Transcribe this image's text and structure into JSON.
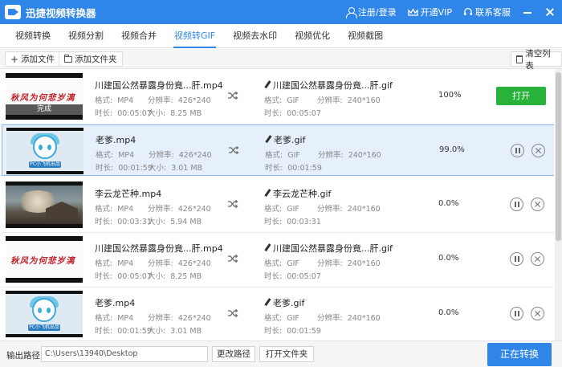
{
  "app": {
    "title": "迅捷视频转换器",
    "actions": {
      "login": "注册/登录",
      "vip": "开通VIP",
      "service": "联系客服"
    }
  },
  "tabs": [
    {
      "label": "视频转换"
    },
    {
      "label": "视频分割"
    },
    {
      "label": "视频合并"
    },
    {
      "label": "视频转GIF"
    },
    {
      "label": "视频去水印"
    },
    {
      "label": "视频优化"
    },
    {
      "label": "视频截图"
    }
  ],
  "active_tab": "视频转GIF",
  "toolbar": {
    "add_file": "添加文件",
    "add_folder": "添加文件夹",
    "clear_list": "清空列表"
  },
  "field_labels": {
    "format": "格式:",
    "resolution": "分辨率:",
    "duration": "时长:",
    "size": "大小:"
  },
  "rows": [
    {
      "thumb": "calligraphy",
      "thumb_text": "秋风为何悲岁漓",
      "status_label": "完成",
      "src_name": "川建国公然暴露身份竟...肝.mp4",
      "src_format": "MP4",
      "src_resolution": "426*240",
      "src_duration": "00:05:07",
      "src_size": "8.25 MB",
      "dst_name": "川建国公然暴露身份竟...肝.gif",
      "dst_format": "GIF",
      "dst_resolution": "240*160",
      "dst_duration": "00:05:07",
      "progress": "100%",
      "action_label": "打开"
    },
    {
      "thumb": "anime",
      "thumb_text": "PC小飞机出品",
      "src_name": "老爹.mp4",
      "src_format": "MP4",
      "src_resolution": "426*240",
      "src_duration": "00:01:59",
      "src_size": "3.01 MB",
      "dst_name": "老爹.gif",
      "dst_format": "GIF",
      "dst_resolution": "240*160",
      "dst_duration": "00:01:59",
      "progress": "99.0%"
    },
    {
      "thumb": "scene",
      "src_name": "李云龙芒种.mp4",
      "src_format": "MP4",
      "src_resolution": "426*240",
      "src_duration": "00:03:31",
      "src_size": "5.94 MB",
      "dst_name": "李云龙芒种.gif",
      "dst_format": "GIF",
      "dst_resolution": "240*160",
      "dst_duration": "00:03:31",
      "progress": "0.0%"
    },
    {
      "thumb": "calligraphy",
      "thumb_text": "秋风为何悲岁漓",
      "src_name": "川建国公然暴露身份竟...肝.mp4",
      "src_format": "MP4",
      "src_resolution": "426*240",
      "src_duration": "00:05:07",
      "src_size": "8.25 MB",
      "dst_name": "川建国公然暴露身份竟...肝.gif",
      "dst_format": "GIF",
      "dst_resolution": "240*160",
      "dst_duration": "00:05:07",
      "progress": "0.0%"
    },
    {
      "thumb": "anime",
      "thumb_text": "PC小飞机出品",
      "src_name": "老爹.mp4",
      "src_format": "MP4",
      "src_resolution": "426*240",
      "src_duration": "00:01:59",
      "src_size": "3.01 MB",
      "dst_name": "老爹.gif",
      "dst_format": "GIF",
      "dst_resolution": "240*160",
      "dst_duration": "00:01:59",
      "progress": "0.0%"
    }
  ],
  "bottom": {
    "output_label": "输出路径:",
    "output_path": "C:\\Users\\13940\\Desktop",
    "change_path": "更改路径",
    "open_folder": "打开文件夹",
    "convert": "正在转换"
  },
  "colors": {
    "brand_blue": "#2f86e8",
    "open_green": "#27b23a",
    "selected_row": "#e6f0fb"
  }
}
